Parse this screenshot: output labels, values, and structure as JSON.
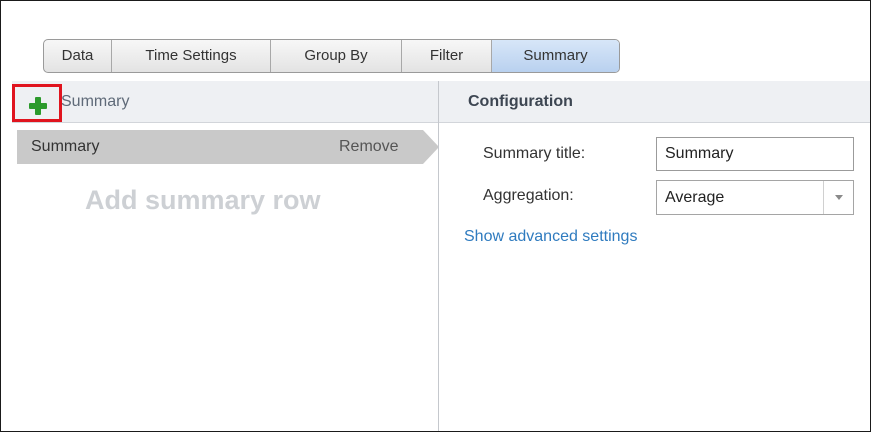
{
  "tabs": [
    {
      "label": "Data"
    },
    {
      "label": "Time Settings"
    },
    {
      "label": "Group By"
    },
    {
      "label": "Filter"
    },
    {
      "label": "Summary",
      "active": true
    }
  ],
  "left_panel": {
    "header_label": "Summary",
    "add_icon": "plus-icon",
    "rows": [
      {
        "label": "Summary",
        "action": "Remove"
      }
    ],
    "empty_hint": "Add summary row"
  },
  "right_panel": {
    "title": "Configuration",
    "summary_title_label": "Summary title:",
    "summary_title_value": "Summary",
    "aggregation_label": "Aggregation:",
    "aggregation_value": "Average",
    "advanced_link": "Show advanced settings"
  },
  "colors": {
    "active_tab": "#b9d1ef",
    "highlight": "#e0141e",
    "add_icon": "#2c9a2c",
    "link": "#2f7bbf",
    "selected_row": "#c9c9c9"
  }
}
